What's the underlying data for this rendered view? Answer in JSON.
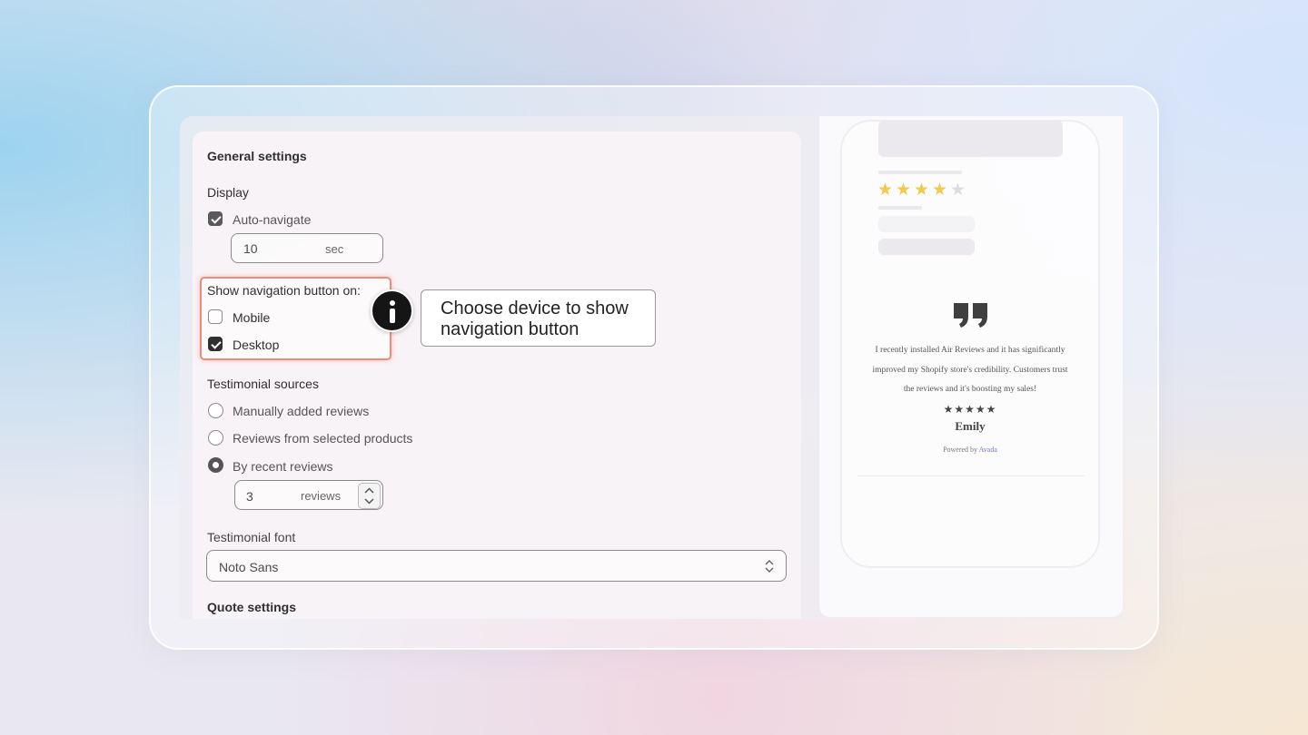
{
  "settings": {
    "title": "General settings",
    "display": {
      "heading": "Display",
      "auto_navigate_label": "Auto-navigate",
      "auto_navigate_checked": true,
      "interval_value": "10",
      "interval_unit": "sec"
    },
    "navigation": {
      "heading": "Show navigation button on:",
      "options": [
        {
          "label": "Mobile",
          "checked": false
        },
        {
          "label": "Desktop",
          "checked": true
        }
      ]
    },
    "sources": {
      "heading": "Testimonial sources",
      "options": [
        {
          "label": "Manually added reviews",
          "selected": false
        },
        {
          "label": "Reviews from selected products",
          "selected": false
        },
        {
          "label": "By recent reviews",
          "selected": true
        }
      ],
      "count_value": "3",
      "count_unit": "reviews"
    },
    "font": {
      "heading": "Testimonial font",
      "value": "Noto Sans"
    },
    "quote_heading": "Quote settings"
  },
  "callout": {
    "icon": "info-icon",
    "text_line1": "Choose device to show",
    "text_line2": "navigation button"
  },
  "preview": {
    "top_rating": 4,
    "top_rating_max": 5,
    "quote_icon": "quote-icon",
    "review_lines": [
      "I recently installed Air Reviews and it has significantly",
      "improved my Shopify store's credibility. Customers trust",
      "the reviews and it's boosting my sales!"
    ],
    "review_stars": "★★★★★",
    "reviewer": "Emily",
    "powered_prefix": "Powered by",
    "powered_brand": "Avada"
  },
  "colors": {
    "highlight_border": "#f08a7c",
    "star_filled": "#f2c94c",
    "star_empty": "#dcdcdc",
    "brand_link": "#6b7bd8"
  }
}
